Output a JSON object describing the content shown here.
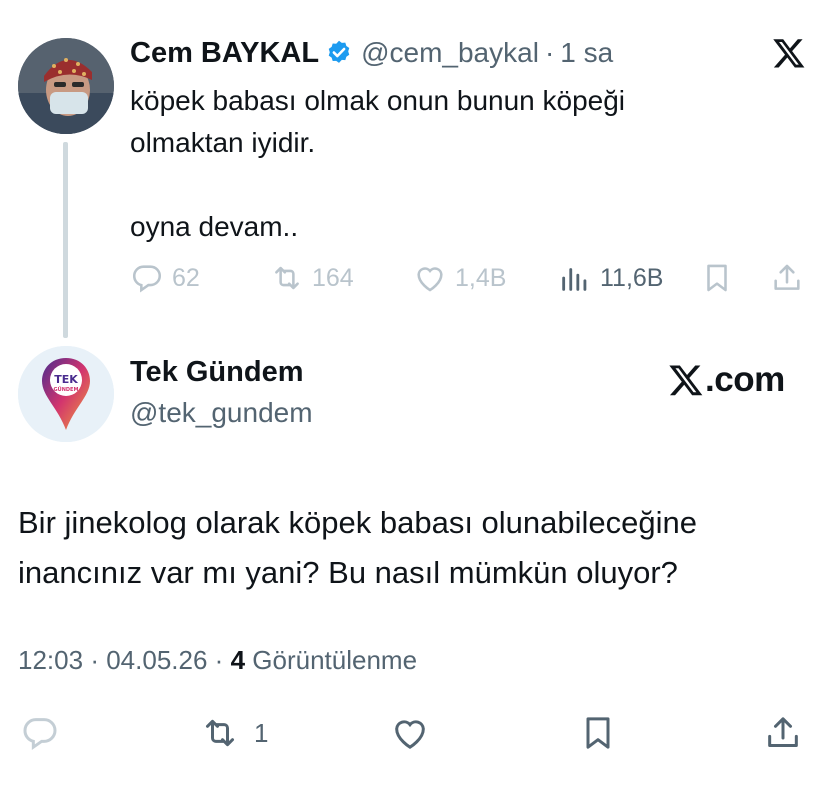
{
  "parent_tweet": {
    "author_name": "Cem BAYKAL",
    "handle": "@cem_baykal",
    "separator": "·",
    "time": "1 sa",
    "text_lines": [
      "köpek babası olmak onun bunun köpeği",
      "olmaktan iyidir.",
      "",
      "oyna devam.."
    ],
    "replies": "62",
    "reposts": "164",
    "likes": "1,4B",
    "views": "11,6B"
  },
  "main_tweet": {
    "author_name": "Tek Gündem",
    "handle": "@tek_gundem",
    "avatar_text": "TEK",
    "avatar_subtext": "GÜNDEM",
    "brand_suffix": ".com",
    "text": "Bir jinekolog olarak köpek babası olunabileceğine inancınız var mı yani? Bu nasıl mümkün oluyor?",
    "time": "12:03",
    "date": "04.05.26",
    "separator": "·",
    "view_count": "4",
    "view_label": "Görüntülenme",
    "reposts": "1"
  },
  "icons": {
    "verified": "verified-badge-icon",
    "x_logo": "x-logo-icon",
    "reply": "reply-icon",
    "repost": "repost-icon",
    "like": "heart-icon",
    "views": "analytics-icon",
    "bookmark": "bookmark-icon",
    "share": "share-icon"
  },
  "colors": {
    "verified_blue": "#1d9bf0",
    "text_primary": "#0f1419",
    "text_secondary": "#536471",
    "faded_icon": "#b9c4cc",
    "thread_line": "#cfd9de"
  }
}
